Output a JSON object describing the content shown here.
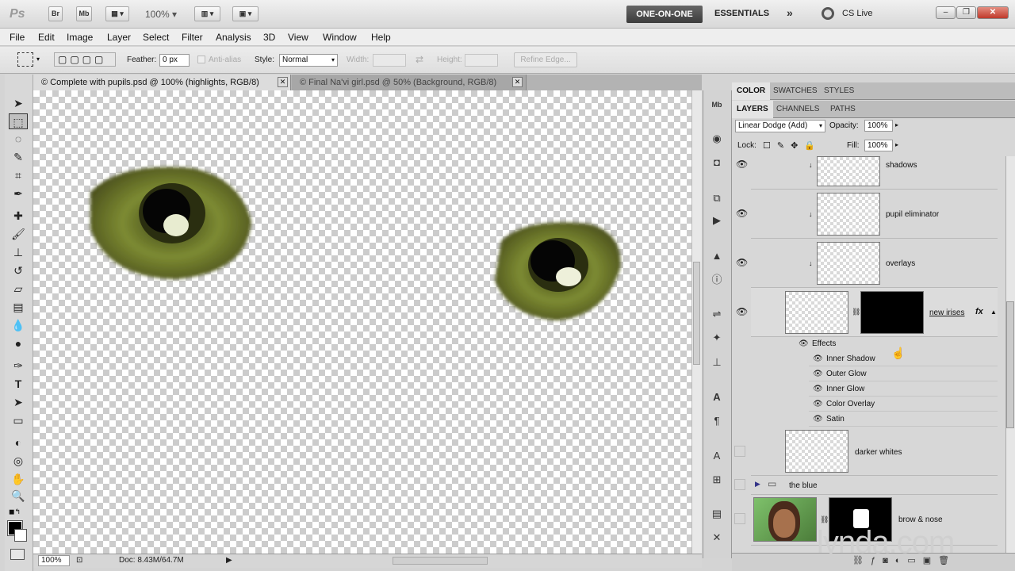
{
  "app": {
    "logo": "Ps",
    "bridge_label": "Br",
    "minibridge_label": "Mb",
    "zoom": "100%"
  },
  "workspace": {
    "active": "ONE-ON-ONE",
    "other": "ESSENTIALS",
    "more": "»",
    "cslive": "CS Live"
  },
  "window_controls": {
    "minimize": "–",
    "restore": "❐",
    "close": "✕"
  },
  "menu": [
    "File",
    "Edit",
    "Image",
    "Layer",
    "Select",
    "Filter",
    "Analysis",
    "3D",
    "View",
    "Window",
    "Help"
  ],
  "options": {
    "feather_label": "Feather:",
    "feather_value": "0 px",
    "antialias_label": "Anti-alias",
    "style_label": "Style:",
    "style_value": "Normal",
    "width_label": "Width:",
    "height_label": "Height:",
    "refine_label": "Refine Edge..."
  },
  "doc_tabs": [
    {
      "label": "Complete with pupils.psd @ 100% (highlights, RGB/8)",
      "close": "✕"
    },
    {
      "label": "Final Na'vi girl.psd @ 50% (Background, RGB/8)",
      "close": "✕"
    }
  ],
  "status": {
    "zoom": "100%",
    "doc": "Doc: 8.43M/64.7M",
    "arrow": "▶"
  },
  "panels": {
    "top_tabs": [
      "COLOR",
      "SWATCHES",
      "STYLES"
    ],
    "layer_tabs": [
      "LAYERS",
      "CHANNELS",
      "PATHS"
    ],
    "blend_mode": "Linear Dodge (Add)",
    "opacity_label": "Opacity:",
    "opacity_value": "100%",
    "lock_label": "Lock:",
    "fill_label": "Fill:",
    "fill_value": "100%"
  },
  "layers": [
    {
      "name": "shadows",
      "visible": true
    },
    {
      "name": "pupil eliminator",
      "visible": true
    },
    {
      "name": "overlays",
      "visible": true
    },
    {
      "name": "new irises",
      "visible": true,
      "fx": "fx"
    },
    {
      "name": "darker whites",
      "visible": false
    },
    {
      "name": "the blue",
      "visible": false
    },
    {
      "name": "brow & nose",
      "visible": false
    }
  ],
  "effects": {
    "header": "Effects",
    "items": [
      "Inner Shadow",
      "Outer Glow",
      "Inner Glow",
      "Color Overlay",
      "Satin"
    ]
  },
  "watermark": "lynda.com",
  "colors": {
    "accent_dark": "#3c3c3c",
    "iris_green": "#6d7a2e"
  }
}
